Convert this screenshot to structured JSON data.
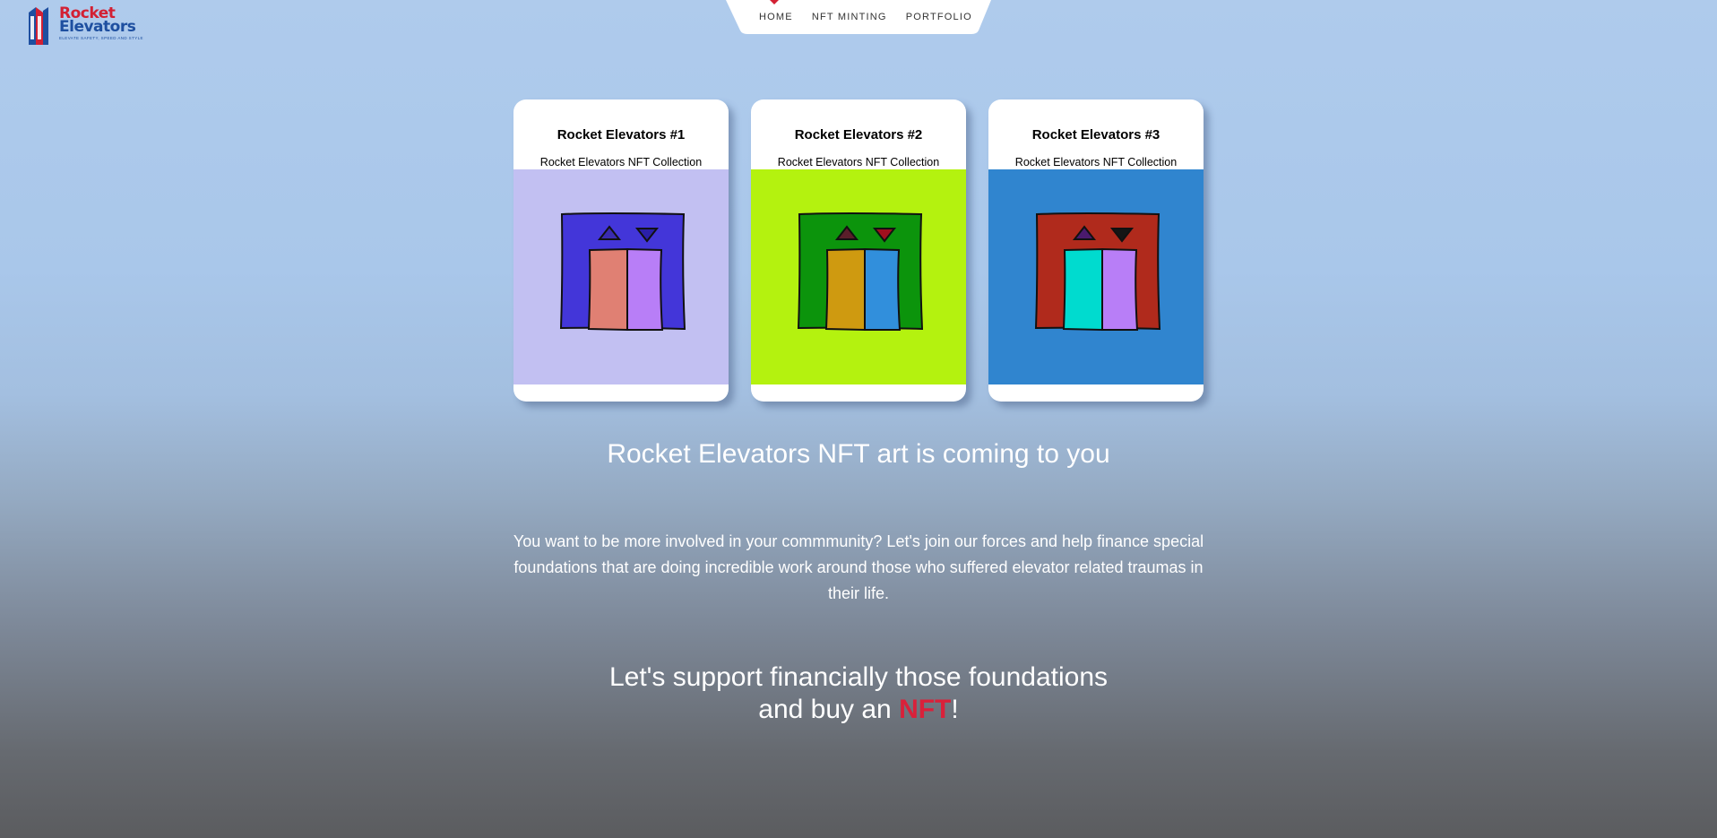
{
  "brand": {
    "logo_line1": "Rocket",
    "logo_line2": "Elevators",
    "logo_tagline": "ELEVATE SAFETY, SPEED AND STYLE",
    "primary_color": "#d32033",
    "secondary_color": "#1e4fa0"
  },
  "nav": {
    "items": [
      {
        "label": "HOME"
      },
      {
        "label": "NFT MINTING"
      },
      {
        "label": "PORTFOLIO"
      }
    ]
  },
  "cards": [
    {
      "title": "Rocket Elevators #1",
      "subtitle": "Rocket Elevators NFT Collection",
      "colors": {
        "background": "#c2c0f2",
        "frame": "#4336d9",
        "door_left": "#e08073",
        "door_right": "#b87ef7",
        "arrow_up": "#3a2bb0",
        "arrow_down": "#2a1fa8"
      }
    },
    {
      "title": "Rocket Elevators #2",
      "subtitle": "Rocket Elevators NFT Collection",
      "colors": {
        "background": "#b4f20f",
        "frame": "#0c940c",
        "door_left": "#cf9a10",
        "door_right": "#318fdc",
        "arrow_up": "#5a1e2a",
        "arrow_down": "#a00f1e"
      }
    },
    {
      "title": "Rocket Elevators #3",
      "subtitle": "Rocket Elevators NFT Collection",
      "colors": {
        "background": "#3085cf",
        "frame": "#b02a1c",
        "door_left": "#00dbcf",
        "door_right": "#b87ef7",
        "arrow_up": "#4a1a6e",
        "arrow_down": "#151515"
      }
    }
  ],
  "main": {
    "headline": "Rocket Elevators NFT art is coming to you",
    "paragraph": "You want to be more involved in your commmunity? Let's join our forces and help finance special foundations that are doing incredible work around those who suffered elevator related traumas in their life.",
    "cta_line1": "Let's support financially those foundations",
    "cta_line2_prefix": "and buy an ",
    "cta_highlight": "NFT",
    "cta_suffix": "!"
  }
}
